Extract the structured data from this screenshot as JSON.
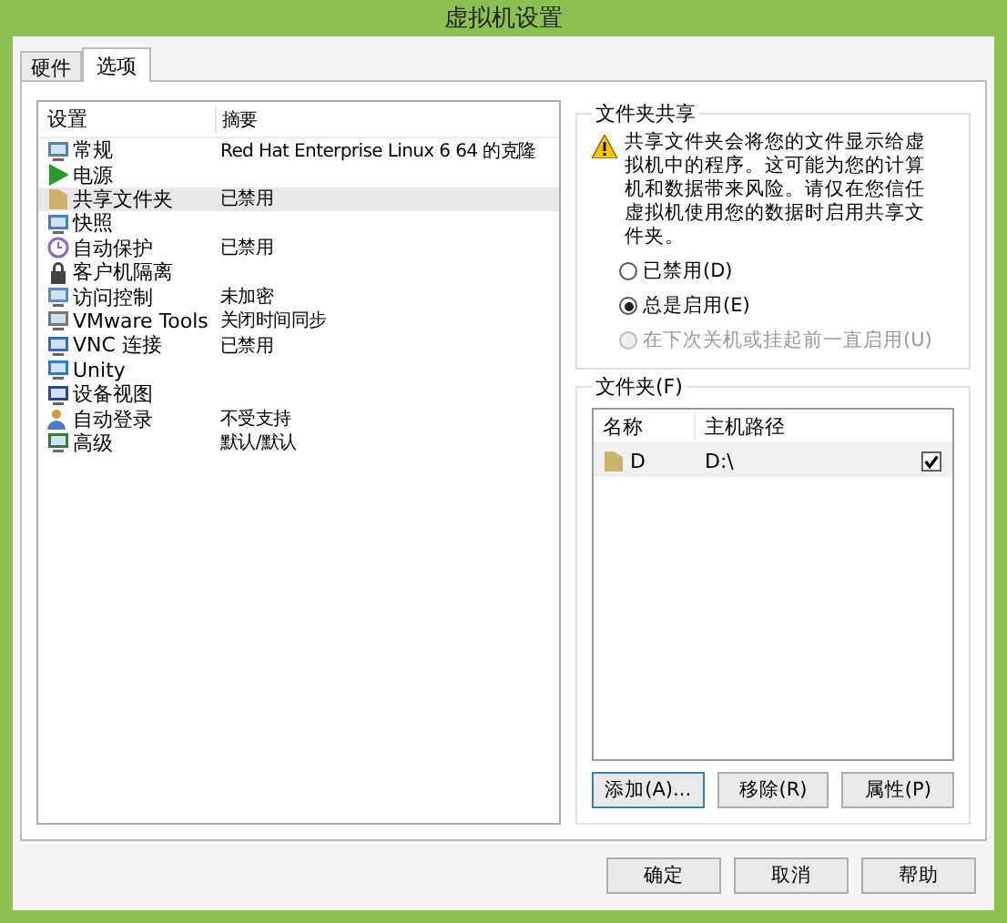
{
  "window": {
    "title": "虚拟机设置"
  },
  "tabs": [
    {
      "label": "硬件",
      "selected": false
    },
    {
      "label": "选项",
      "selected": true
    }
  ],
  "settings": {
    "columns": [
      "设置",
      "摘要"
    ],
    "rows": [
      {
        "kind": "monitor",
        "name": "常规",
        "summary": "Red Hat Enterprise Linux 6 64  的克隆",
        "selected": false
      },
      {
        "kind": "play",
        "name": "电源",
        "selected": false
      },
      {
        "kind": "folder",
        "name": "共享文件夹",
        "summary": "已禁用",
        "selected": true
      },
      {
        "kind": "camera",
        "name": "快照",
        "selected": false
      },
      {
        "kind": "clock",
        "name": "自动保护",
        "summary": "已禁用",
        "selected": false
      },
      {
        "kind": "lock",
        "name": "客户机隔离",
        "selected": false
      },
      {
        "kind": "shield",
        "name": "访问控制",
        "summary": "未加密",
        "selected": false
      },
      {
        "kind": "vm",
        "name": "VMware Tools",
        "summary": "关闭时间同步",
        "selected": false
      },
      {
        "kind": "screen",
        "name": "VNC 连接",
        "summary": "已禁用",
        "selected": false
      },
      {
        "kind": "window",
        "name": "Unity",
        "selected": false
      },
      {
        "kind": "device",
        "name": "设备视图",
        "selected": false
      },
      {
        "kind": "user",
        "name": "自动登录",
        "summary": "不受支持",
        "selected": false
      },
      {
        "kind": "chart",
        "name": "高级",
        "summary": "默认/默认",
        "selected": false
      }
    ]
  },
  "sharing": {
    "title": "文件夹共享",
    "warning": "共享文件夹会将您的文件显示给虚拟机中的程序。这可能为您的计算机和数据带来风险。请仅在您信任虚拟机使用您的数据时启用共享文件夹。",
    "options": [
      {
        "label": "已禁用(D)",
        "selected": false,
        "disabled": false
      },
      {
        "label": "总是启用(E)",
        "selected": true,
        "disabled": false
      },
      {
        "label": "在下次关机或挂起前一直启用(U)",
        "selected": false,
        "disabled": true
      }
    ]
  },
  "folders": {
    "title": "文件夹(F)",
    "columns": [
      "名称",
      "主机路径"
    ],
    "rows": [
      {
        "name": "D",
        "path": "D:\\",
        "checked": true
      }
    ],
    "buttons": [
      "添加(A)...",
      "移除(R)",
      "属性(P)"
    ]
  },
  "buttons": [
    "确定",
    "取消",
    "帮助"
  ]
}
